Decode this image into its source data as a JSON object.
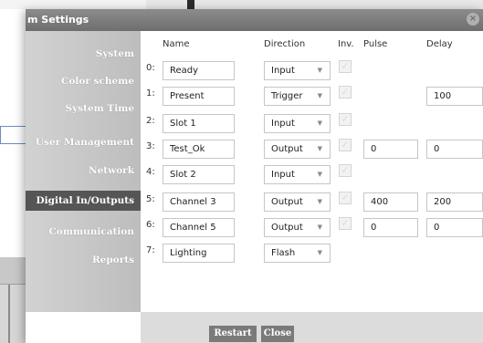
{
  "dialog": {
    "title": "m Settings",
    "close_glyph": "×"
  },
  "sidebar": {
    "items": [
      {
        "label": "System"
      },
      {
        "label": "Color scheme"
      },
      {
        "label": "System Time"
      },
      {
        "label": "User Management"
      },
      {
        "label": "Network"
      },
      {
        "label": "Digital In/Outputs",
        "active": true
      },
      {
        "label": "Communication"
      },
      {
        "label": "Reports"
      }
    ]
  },
  "table": {
    "headers": {
      "name": "Name",
      "direction": "Direction",
      "inv": "Inv.",
      "pulse": "Pulse",
      "delay": "Delay"
    },
    "rows": [
      {
        "index": "0:",
        "name": "Ready",
        "direction": "Input",
        "pulse": null,
        "delay": null
      },
      {
        "index": "1:",
        "name": "Present",
        "direction": "Trigger",
        "pulse": null,
        "delay": "100"
      },
      {
        "index": "2:",
        "name": "Slot 1",
        "direction": "Input",
        "pulse": null,
        "delay": null
      },
      {
        "index": "3:",
        "name": "Test_Ok",
        "direction": "Output",
        "pulse": "0",
        "delay": "0"
      },
      {
        "index": "4:",
        "name": "Slot 2",
        "direction": "Input",
        "pulse": null,
        "delay": null
      },
      {
        "index": "5:",
        "name": "Channel 3",
        "direction": "Output",
        "pulse": "400",
        "delay": "200"
      },
      {
        "index": "6:",
        "name": "Channel 5",
        "direction": "Output",
        "pulse": "0",
        "delay": "0"
      },
      {
        "index": "7:",
        "name": "Lighting",
        "direction": "Flash",
        "pulse": null,
        "delay": null,
        "no_inv": true
      }
    ]
  },
  "footer": {
    "restart_label": "Restart",
    "close_label": "Close"
  },
  "icons": {
    "checkmark": "✓",
    "caret": "▼"
  },
  "colors": {
    "titlebar": "#7a7a7a",
    "sidebar_active": "#555555",
    "button": "#7a7a7a"
  }
}
